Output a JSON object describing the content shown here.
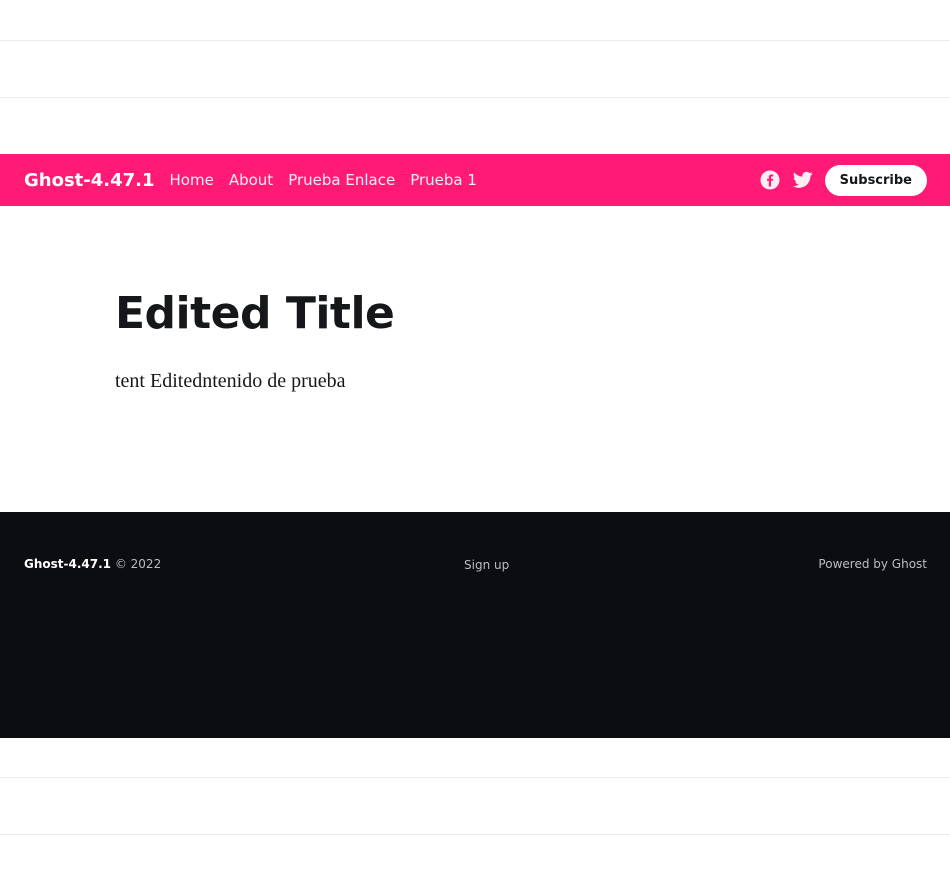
{
  "colors": {
    "accent": "#ff1a75",
    "text_dark": "#15171a",
    "footer_bg": "#0c0d10"
  },
  "header": {
    "site_title": "Ghost-4.47.1",
    "nav_items": [
      {
        "label": "Home"
      },
      {
        "label": "About"
      },
      {
        "label": "Prueba Enlace"
      },
      {
        "label": "Prueba 1"
      }
    ],
    "social_icons": [
      "facebook-icon",
      "twitter-icon"
    ],
    "subscribe_label": "Subscribe"
  },
  "post": {
    "title": "Edited Title",
    "body": "tent Editedntenido de prueba"
  },
  "footer": {
    "site_title": "Ghost-4.47.1",
    "copyright": "© 2022",
    "signup_label": "Sign up",
    "powered_by": "Powered by Ghost"
  }
}
